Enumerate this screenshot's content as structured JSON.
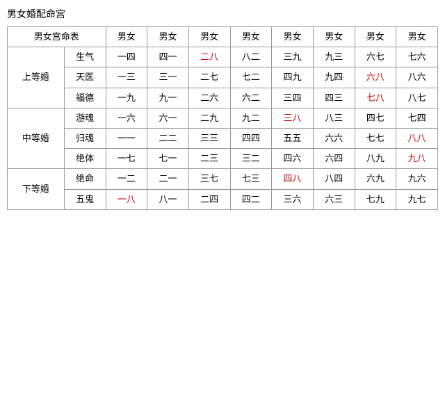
{
  "title": "男女婚配命宫",
  "table": {
    "header": {
      "col0": "男女宫命表",
      "cols": [
        "男女",
        "男女",
        "男女",
        "男女",
        "男女",
        "男女",
        "男女",
        "男女"
      ]
    },
    "rows": [
      {
        "grade": "上等婚",
        "grade_rowspan": 3,
        "sub": "生气",
        "cells": [
          {
            "text": "一四",
            "red": false
          },
          {
            "text": "四一",
            "red": false
          },
          {
            "text": "二八",
            "red": true
          },
          {
            "text": "八二",
            "red": false
          },
          {
            "text": "三九",
            "red": false
          },
          {
            "text": "九三",
            "red": false
          },
          {
            "text": "六七",
            "red": false
          },
          {
            "text": "七六",
            "red": false
          }
        ]
      },
      {
        "grade": null,
        "sub": "天医",
        "cells": [
          {
            "text": "一三",
            "red": false
          },
          {
            "text": "三一",
            "red": false
          },
          {
            "text": "二七",
            "red": false
          },
          {
            "text": "七二",
            "red": false
          },
          {
            "text": "四九",
            "red": false
          },
          {
            "text": "九四",
            "red": false
          },
          {
            "text": "六八",
            "red": true
          },
          {
            "text": "八六",
            "red": false
          }
        ]
      },
      {
        "grade": null,
        "sub": "福德",
        "cells": [
          {
            "text": "一九",
            "red": false
          },
          {
            "text": "九一",
            "red": false
          },
          {
            "text": "二六",
            "red": false
          },
          {
            "text": "六二",
            "red": false
          },
          {
            "text": "三四",
            "red": false
          },
          {
            "text": "四三",
            "red": false
          },
          {
            "text": "七八",
            "red": true
          },
          {
            "text": "八七",
            "red": false
          }
        ]
      },
      {
        "grade": "中等婚",
        "grade_rowspan": 3,
        "sub": "游魂",
        "cells": [
          {
            "text": "一六",
            "red": false
          },
          {
            "text": "六一",
            "red": false
          },
          {
            "text": "二九",
            "red": false
          },
          {
            "text": "九二",
            "red": false
          },
          {
            "text": "三八",
            "red": true
          },
          {
            "text": "八三",
            "red": false
          },
          {
            "text": "四七",
            "red": false
          },
          {
            "text": "七四",
            "red": false
          }
        ]
      },
      {
        "grade": null,
        "sub": "归魂",
        "cells": [
          {
            "text": "一一",
            "red": false
          },
          {
            "text": "二二",
            "red": false
          },
          {
            "text": "三三",
            "red": false
          },
          {
            "text": "四四",
            "red": false
          },
          {
            "text": "五五",
            "red": false
          },
          {
            "text": "六六",
            "red": false
          },
          {
            "text": "七七",
            "red": false
          },
          {
            "text": "八八",
            "red": true
          }
        ]
      },
      {
        "grade": null,
        "sub": "绝体",
        "cells": [
          {
            "text": "一七",
            "red": false
          },
          {
            "text": "七一",
            "red": false
          },
          {
            "text": "二三",
            "red": false
          },
          {
            "text": "三二",
            "red": false
          },
          {
            "text": "四六",
            "red": false
          },
          {
            "text": "六四",
            "red": false
          },
          {
            "text": "八九",
            "red": false
          },
          {
            "text": "九八",
            "red": true
          }
        ]
      },
      {
        "grade": "下等婚",
        "grade_rowspan": 2,
        "sub": "绝命",
        "cells": [
          {
            "text": "一二",
            "red": false
          },
          {
            "text": "二一",
            "red": false
          },
          {
            "text": "三七",
            "red": false
          },
          {
            "text": "七三",
            "red": false
          },
          {
            "text": "四八",
            "red": true
          },
          {
            "text": "八四",
            "red": false
          },
          {
            "text": "六九",
            "red": false
          },
          {
            "text": "九六",
            "red": false
          }
        ]
      },
      {
        "grade": null,
        "sub": "五鬼",
        "cells": [
          {
            "text": "一八",
            "red": true
          },
          {
            "text": "八一",
            "red": false
          },
          {
            "text": "二四",
            "red": false
          },
          {
            "text": "四二",
            "red": false
          },
          {
            "text": "三六",
            "red": false
          },
          {
            "text": "六三",
            "red": false
          },
          {
            "text": "七九",
            "red": false
          },
          {
            "text": "九七",
            "red": false
          }
        ]
      }
    ]
  }
}
